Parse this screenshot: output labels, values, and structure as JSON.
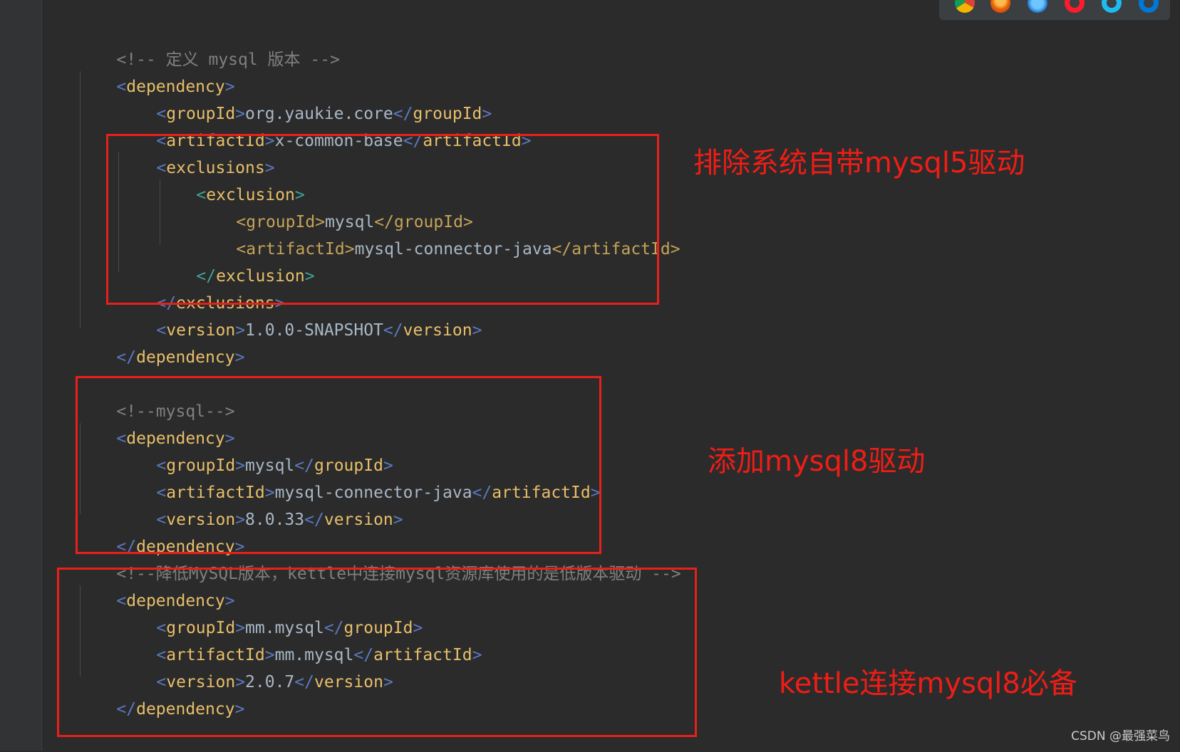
{
  "code": {
    "lines": [
      {
        "comment": "<!-- 定义 mysql 版本 -->"
      },
      {
        "open": "dependency"
      },
      {
        "tag": "groupId",
        "value": "org.yaukie.core"
      },
      {
        "tag": "artifactId",
        "value": "x-common-base"
      },
      {
        "open": "exclusions"
      },
      {
        "open": "exclusion"
      },
      {
        "tag": "groupId",
        "value": "mysql"
      },
      {
        "tag": "artifactId",
        "value": "mysql-connector-java"
      },
      {
        "close": "exclusion"
      },
      {
        "close": "exclusions"
      },
      {
        "tag": "version",
        "value": "1.0.0-SNAPSHOT"
      },
      {
        "close": "dependency"
      },
      {
        "comment": "<!--mysql-->"
      },
      {
        "open": "dependency"
      },
      {
        "tag": "groupId",
        "value": "mysql"
      },
      {
        "tag": "artifactId",
        "value": "mysql-connector-java"
      },
      {
        "tag": "version",
        "value": "8.0.33"
      },
      {
        "close": "dependency"
      },
      {
        "comment": "<!--降低MySQL版本，kettle中连接mysql资源库使用的是低版本驱动 -->"
      },
      {
        "open": "dependency"
      },
      {
        "tag": "groupId",
        "value": "mm.mysql"
      },
      {
        "tag": "artifactId",
        "value": "mm.mysql"
      },
      {
        "tag": "version",
        "value": "2.0.7"
      },
      {
        "close": "dependency"
      }
    ]
  },
  "annotations": {
    "exclude_mysql5": "排除系统自带mysql5驱动",
    "add_mysql8": "添加mysql8驱动",
    "kettle_required": "kettle连接mysql8必备"
  },
  "watermark": "CSDN @最强菜鸟",
  "colors": {
    "background": "#2b2b2b",
    "annotation_red": "#e8201a",
    "tag": "#e8bf6a",
    "bracket": "#5a79c2",
    "comment": "#808080"
  }
}
